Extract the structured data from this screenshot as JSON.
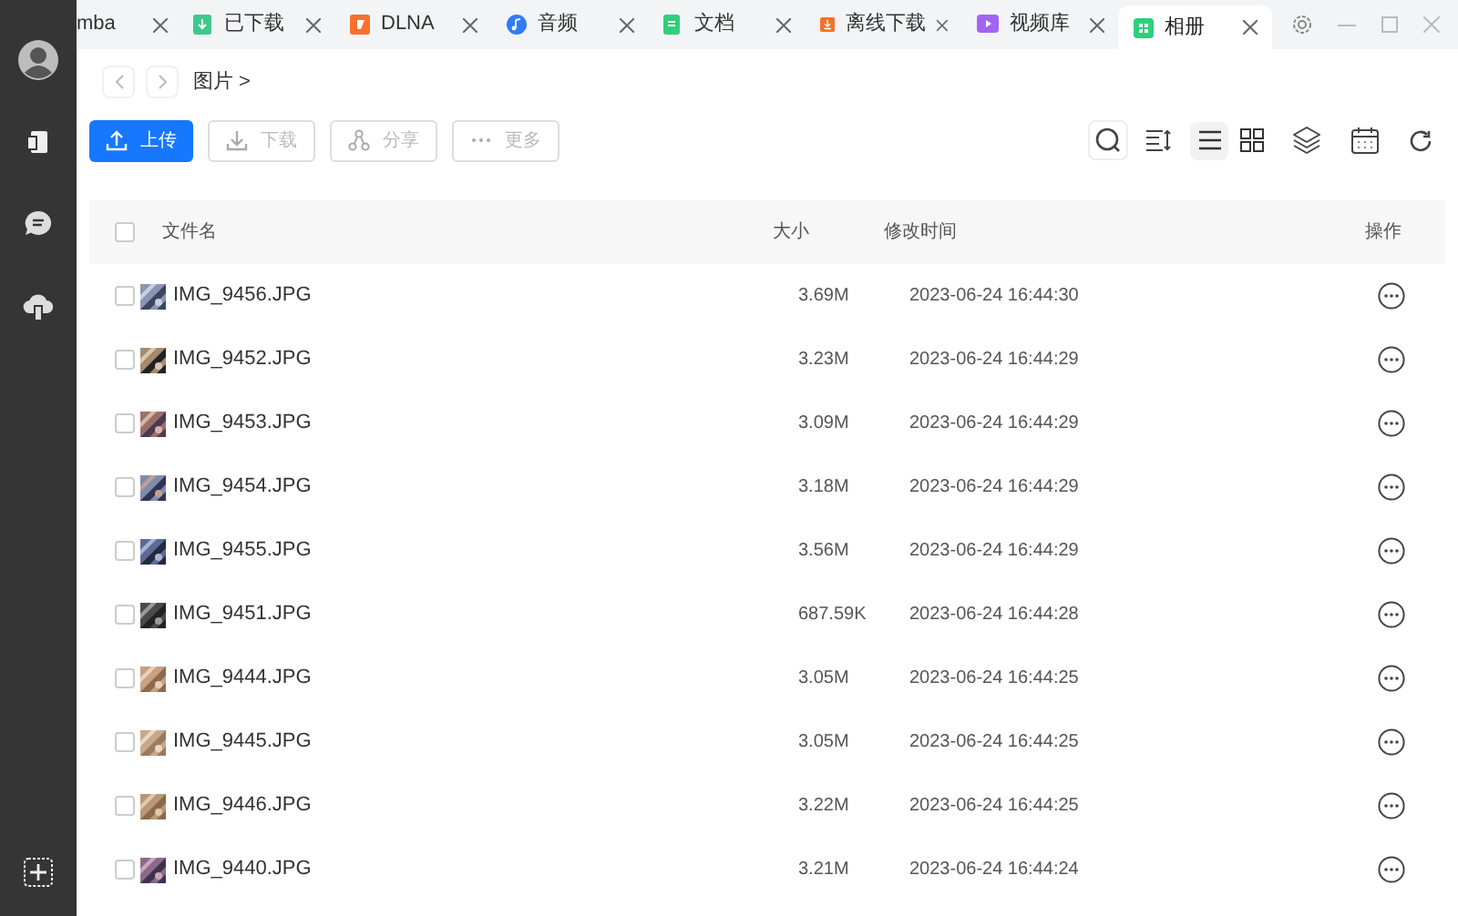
{
  "tabs": [
    {
      "label": "mba",
      "selected": false
    },
    {
      "label": "已下载",
      "color": "#3ec98a",
      "selected": false
    },
    {
      "label": "DLNA",
      "color": "#f7712b",
      "selected": false
    },
    {
      "label": "音频",
      "color": "#2f7cf6",
      "selected": false
    },
    {
      "label": "文档",
      "color": "#2fcf7c",
      "selected": false
    },
    {
      "label": "离线下载",
      "color": "#f7712b",
      "selected": false
    },
    {
      "label": "视频库",
      "color": "#a064f5",
      "selected": false
    },
    {
      "label": "相册",
      "color": "#2fcf7c",
      "selected": true
    }
  ],
  "breadcrumb": "图片 >",
  "actions": [
    {
      "label": "上传",
      "kind": "upload",
      "disabled": false
    },
    {
      "label": "下载",
      "kind": "download",
      "disabled": true
    },
    {
      "label": "分享",
      "kind": "share",
      "disabled": true
    },
    {
      "label": "更多",
      "kind": "more",
      "disabled": true
    }
  ],
  "view_modes": [
    {
      "kind": "list",
      "selected": true
    },
    {
      "kind": "grid",
      "selected": false
    }
  ],
  "table": {
    "all_checked": false,
    "columns": [
      "文件名",
      "大小",
      "修改时间",
      "操作"
    ],
    "rows": [
      {
        "name": "IMG_9456.JPG",
        "size": "3.69M",
        "modified": "2023-06-24 16:44:30",
        "checked": false
      },
      {
        "name": "IMG_9452.JPG",
        "size": "3.23M",
        "modified": "2023-06-24 16:44:29",
        "checked": false
      },
      {
        "name": "IMG_9453.JPG",
        "size": "3.09M",
        "modified": "2023-06-24 16:44:29",
        "checked": false
      },
      {
        "name": "IMG_9454.JPG",
        "size": "3.18M",
        "modified": "2023-06-24 16:44:29",
        "checked": false
      },
      {
        "name": "IMG_9455.JPG",
        "size": "3.56M",
        "modified": "2023-06-24 16:44:29",
        "checked": false
      },
      {
        "name": "IMG_9451.JPG",
        "size": "687.59K",
        "modified": "2023-06-24 16:44:28",
        "checked": false
      },
      {
        "name": "IMG_9444.JPG",
        "size": "3.05M",
        "modified": "2023-06-24 16:44:25",
        "checked": false
      },
      {
        "name": "IMG_9445.JPG",
        "size": "3.05M",
        "modified": "2023-06-24 16:44:25",
        "checked": false
      },
      {
        "name": "IMG_9446.JPG",
        "size": "3.22M",
        "modified": "2023-06-24 16:44:25",
        "checked": false
      },
      {
        "name": "IMG_9440.JPG",
        "size": "3.21M",
        "modified": "2023-06-24 16:44:24",
        "checked": false
      }
    ]
  }
}
